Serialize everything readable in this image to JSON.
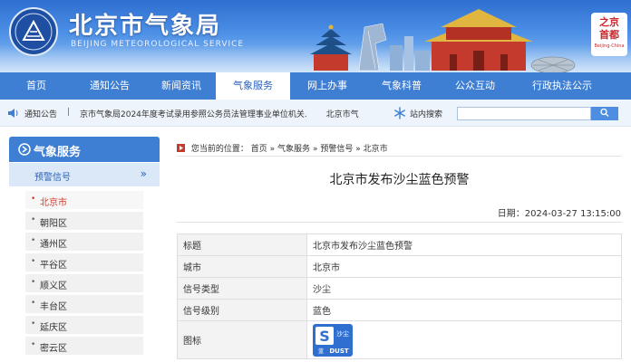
{
  "header": {
    "title_cn": "北京市气象局",
    "title_en": "BEIJING METEOROLOGICAL SERVICE",
    "badge_cn_line1": "之京",
    "badge_cn_line2": "首都",
    "badge_en": "Beijing-China"
  },
  "nav": {
    "items": [
      {
        "label": "首页"
      },
      {
        "label": "通知公告"
      },
      {
        "label": "新闻资讯"
      },
      {
        "label": "气象服务"
      },
      {
        "label": "网上办事"
      },
      {
        "label": "气象科普"
      },
      {
        "label": "公众互动"
      },
      {
        "label": "行政执法公示"
      }
    ],
    "active": "气象服务"
  },
  "notice": {
    "label": "通知公告",
    "separator": "|",
    "items": [
      "京市气象局2024年度考试录用参照公务员法管理事业单位机关.",
      "北京市气"
    ],
    "search_label": "站内搜索",
    "search_value": ""
  },
  "sidebar": {
    "title": "气象服务",
    "sub_title": "预警信号",
    "sub_arrow": "»",
    "districts": [
      {
        "label": "北京市",
        "active": true
      },
      {
        "label": "朝阳区",
        "active": false
      },
      {
        "label": "通州区",
        "active": false
      },
      {
        "label": "平谷区",
        "active": false
      },
      {
        "label": "顺义区",
        "active": false
      },
      {
        "label": "丰台区",
        "active": false
      },
      {
        "label": "延庆区",
        "active": false
      },
      {
        "label": "密云区",
        "active": false
      }
    ]
  },
  "breadcrumb": {
    "prefix": "您当前的位置：",
    "items": [
      "首页",
      "气象服务",
      "预警信号",
      "北京市"
    ],
    "separator": "»"
  },
  "article": {
    "title": "北京市发布沙尘蓝色预警",
    "date": "日期：2024-03-27 13:15:00"
  },
  "table": {
    "rows": [
      {
        "key": "标题",
        "value": "北京市发布沙尘蓝色预警"
      },
      {
        "key": "城市",
        "value": "北京市"
      },
      {
        "key": "信号类型",
        "value": "沙尘"
      },
      {
        "key": "信号级别",
        "value": "蓝色"
      },
      {
        "key": "图标",
        "value": ""
      }
    ],
    "icon": {
      "letter": "S",
      "cn": "沙尘",
      "cn_small": "蓝",
      "en": "DUST",
      "color": "#2f6fd0"
    }
  },
  "colors": {
    "nav_bg": "#3f7fd3",
    "active_text": "#2c62b8",
    "active_district": "#d03a2a"
  }
}
